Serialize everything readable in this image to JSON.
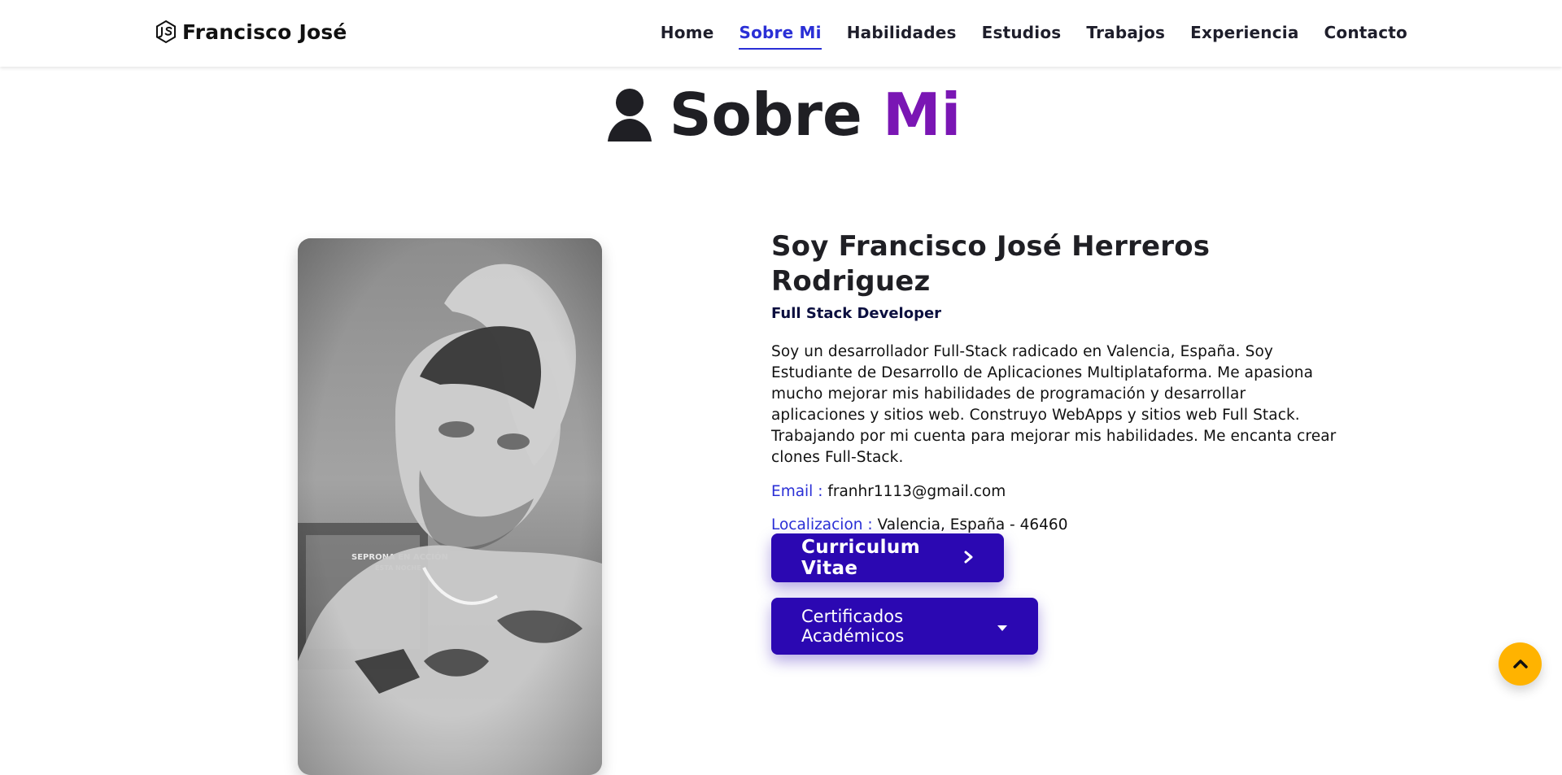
{
  "header": {
    "brand": {
      "text": "Francisco José",
      "icon": "node-js-hexagon-icon"
    },
    "nav": {
      "items": [
        {
          "label": "Home",
          "active": false
        },
        {
          "label": "Sobre Mi",
          "active": true
        },
        {
          "label": "Habilidades",
          "active": false
        },
        {
          "label": "Estudios",
          "active": false
        },
        {
          "label": "Trabajos",
          "active": false
        },
        {
          "label": "Experiencia",
          "active": false
        },
        {
          "label": "Contacto",
          "active": false
        }
      ]
    }
  },
  "section": {
    "title_prefix": "Sobre",
    "title_accent": "Mi",
    "icon": "user-icon",
    "accent_color": "#7a16b4"
  },
  "about": {
    "name": "Soy Francisco José Herreros Rodriguez",
    "role": "Full Stack Developer",
    "bio": "Soy un desarrollador Full-Stack radicado en Valencia, España. Soy Estudiante de Desarrollo de Aplicaciones Multiplataforma. Me apasiona mucho mejorar mis habilidades de programación y desarrollar aplicaciones y sitios web. Construyo WebApps y sitios web Full Stack. Trabajando por mi cuenta para mejorar mis habilidades. Me encanta crear clones Full-Stack.",
    "email": {
      "label": "Email :",
      "value": "franhr1113@gmail.com"
    },
    "location": {
      "label": "Localizacion :",
      "value": "Valencia, España - 46460"
    },
    "buttons": {
      "cv": {
        "label": "Curriculum Vitae",
        "icon": "chevron-right-icon"
      },
      "certs": {
        "label": "Certificados Académicos",
        "icon": "caret-down-icon"
      }
    },
    "photo": {
      "alt": "profile-photo",
      "style": "grayscale"
    }
  },
  "ui": {
    "to_top": {
      "icon": "chevron-up-icon",
      "color": "#ffb300"
    },
    "primary_button_color": "#2b08b2",
    "link_color": "#2a2fd6"
  }
}
